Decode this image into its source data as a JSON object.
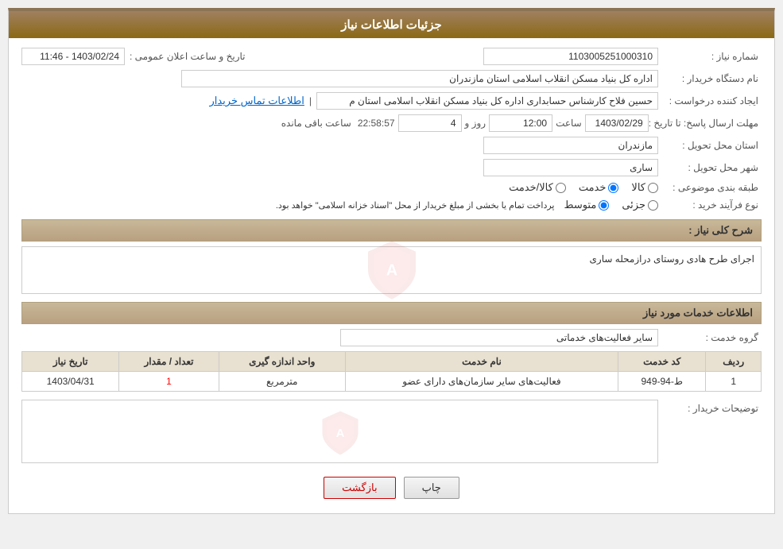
{
  "header": {
    "title": "جزئیات اطلاعات نیاز"
  },
  "fields": {
    "shomare_niaz_label": "شماره نیاز :",
    "shomare_niaz_value": "1103005251000310",
    "name_dastasgah_label": "نام دستگاه خریدار :",
    "name_dastasgah_value": "اداره کل بنیاد مسکن انقلاب اسلامی استان مازندران",
    "tarikh_label": "تاریخ و ساعت اعلان عمومی :",
    "tarikh_value": "1403/02/24 - 11:46",
    "ijad_label": "ایجاد کننده درخواست :",
    "ijad_value": "حسین فلاح کارشناس حسابداری اداره کل بنیاد مسکن انقلاب اسلامی استان م",
    "ijad_link": "اطلاعات تماس خریدار",
    "mohlat_label": "مهلت ارسال پاسخ: تا تاریخ :",
    "mohlat_date": "1403/02/29",
    "mohlat_saat_label": "ساعت",
    "mohlat_saat": "12:00",
    "mohlat_roz_label": "روز و",
    "mohlat_roz": "4",
    "mohlat_saat2": "22:58:57",
    "mohlat_mande_label": "ساعت باقی مانده",
    "ostan_label": "استان محل تحویل :",
    "ostan_value": "مازندران",
    "shahr_label": "شهر محل تحویل :",
    "shahr_value": "ساری",
    "tabaqe_label": "طبقه بندی موضوعی :",
    "tabaqe_options": [
      "کالا",
      "خدمت",
      "کالا/خدمت"
    ],
    "tabaqe_selected": "خدمت",
    "noefrayand_label": "نوع فرآیند خرید :",
    "noefrayand_options": [
      "جزئی",
      "متوسط"
    ],
    "noefrayand_selected": "متوسط",
    "noefrayand_note": "پرداخت تمام یا بخشی از مبلغ خریدار از محل \"اسناد خزانه اسلامی\" خواهد بود.",
    "sharh_label": "شرح کلی نیاز :",
    "sharh_value": "اجرای طرح هادی روستای درازمحله ساری",
    "khadamat_header": "اطلاعات خدمات مورد نیاز",
    "grohe_khedmat_label": "گروه خدمت :",
    "grohe_khedmat_value": "سایر فعالیت‌های خدماتی",
    "table": {
      "headers": [
        "ردیف",
        "کد خدمت",
        "نام خدمت",
        "واحد اندازه گیری",
        "تعداد / مقدار",
        "تاریخ نیاز"
      ],
      "rows": [
        {
          "radif": "1",
          "kod": "ط-94-949",
          "name": "فعالیت‌های سایر سازمان‌های دارای عضو",
          "vahed": "مترمربع",
          "tedad": "1",
          "tarikh": "1403/04/31"
        }
      ]
    },
    "tozihat_label": "توضیحات خریدار :",
    "tozihat_value": ""
  },
  "buttons": {
    "print_label": "چاپ",
    "back_label": "بازگشت"
  }
}
